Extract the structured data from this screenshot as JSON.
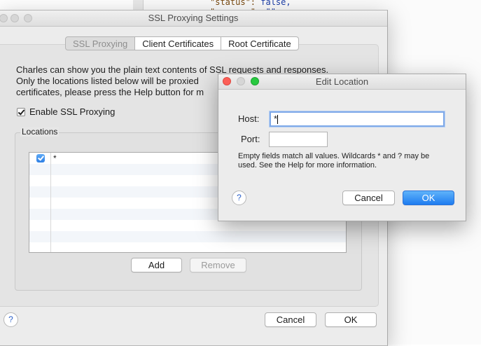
{
  "editor": {
    "code_lines": [
      {
        "key": "\"status\": ",
        "val": "false,"
      },
      {
        "key": "\"message\": ",
        "val": "\"\""
      }
    ]
  },
  "main_window": {
    "title": "SSL Proxying Settings",
    "tabs": [
      {
        "label": "SSL Proxying",
        "active": true
      },
      {
        "label": "Client Certificates",
        "active": false
      },
      {
        "label": "Root Certificate",
        "active": false
      }
    ],
    "description_lines": [
      "Charles can show you the plain text contents of SSL requests and responses.",
      "Only the locations listed below will be proxied",
      "certificates, please press the Help button for m"
    ],
    "enable_ssl_label": "Enable SSL Proxying",
    "enable_ssl_checked": true,
    "locations_label": "Locations",
    "locations": [
      {
        "enabled": true,
        "host": "*"
      }
    ],
    "add_label": "Add",
    "remove_label": "Remove",
    "help_label": "?",
    "cancel_label": "Cancel",
    "ok_label": "OK"
  },
  "dialog": {
    "title": "Edit Location",
    "host_label": "Host:",
    "host_value": "*",
    "port_label": "Port:",
    "port_value": "",
    "hint_text": "Empty fields match all values. Wildcards * and ? may be used. See the Help for more information.",
    "help_label": "?",
    "cancel_label": "Cancel",
    "ok_label": "OK"
  },
  "colors": {
    "accent": "#1e7cf0",
    "close_light": "#fc5f57",
    "minimize_light": "#fdbc2e",
    "zoom_light": "#28c940"
  }
}
